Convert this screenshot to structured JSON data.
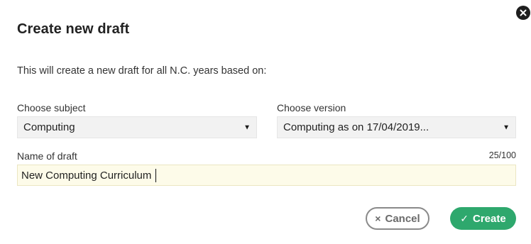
{
  "dialog": {
    "title": "Create new draft",
    "intro": "This will create a new draft for all N.C. years based on:"
  },
  "subject": {
    "label": "Choose subject",
    "value": "Computing"
  },
  "version": {
    "label": "Choose version",
    "value": "Computing as on 17/04/2019..."
  },
  "name": {
    "label": "Name of draft",
    "value": "New Computing Curriculum",
    "counter": "25/100"
  },
  "actions": {
    "cancel_label": "Cancel",
    "create_label": "Create",
    "cancel_glyph": "×",
    "create_glyph": "✓"
  },
  "icons": {
    "close": "close-icon",
    "dropdown": "caret-down-icon",
    "cancel": "x-icon",
    "create": "check-icon"
  },
  "colors": {
    "primary": "#2ea86d",
    "select_bg": "#f2f2f2",
    "input_bg": "#fdfbe9",
    "cancel_border": "#8a8a8a"
  }
}
